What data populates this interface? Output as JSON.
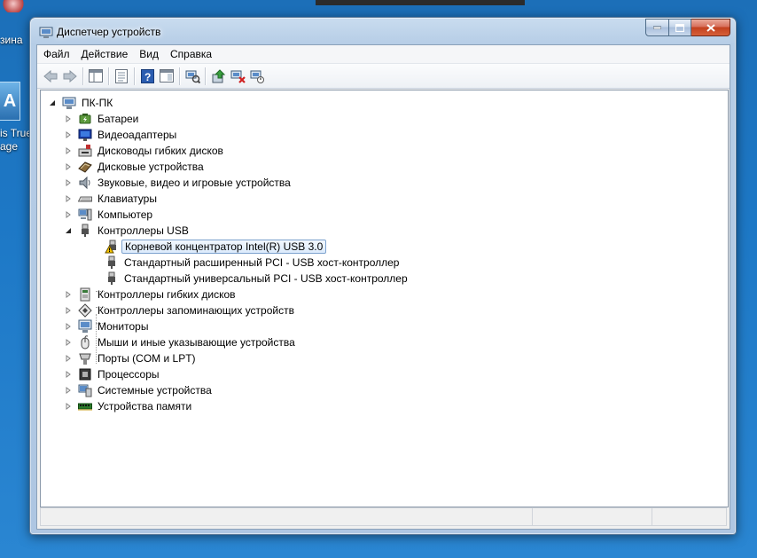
{
  "desktop": {
    "label_top": "зина",
    "label_mid1": "is True",
    "label_mid2": "age",
    "app_icon_letter": "A"
  },
  "window": {
    "title": "Диспетчер устройств",
    "icon": "device-manager-icon"
  },
  "menu": [
    "Файл",
    "Действие",
    "Вид",
    "Справка"
  ],
  "toolbar": {
    "buttons": [
      "back-icon",
      "forward-icon",
      "show-hide-console-tree-icon",
      "properties-icon",
      "help-icon",
      "action-pane-icon",
      "scan-hardware-icon",
      "update-driver-icon",
      "uninstall-icon",
      "enable-device-icon"
    ]
  },
  "tree": {
    "root": "ПК-ПК",
    "categories": [
      {
        "label": "Батареи",
        "icon": "battery-icon"
      },
      {
        "label": "Видеоадаптеры",
        "icon": "display-adapter-icon"
      },
      {
        "label": "Дисководы гибких дисков",
        "icon": "floppy-drive-icon"
      },
      {
        "label": "Дисковые устройства",
        "icon": "disk-drive-icon"
      },
      {
        "label": "Звуковые, видео и игровые устройства",
        "icon": "speaker-icon"
      },
      {
        "label": "Клавиатуры",
        "icon": "keyboard-icon"
      },
      {
        "label": "Компьютер",
        "icon": "computer-icon"
      },
      {
        "label": "Контроллеры USB",
        "icon": "usb-icon",
        "expanded": true,
        "children": [
          {
            "label": "Корневой концентратор Intel(R) USB 3.0",
            "icon": "usb-warning-icon",
            "selected": true
          },
          {
            "label": "Стандартный расширенный PCI - USB хост-контроллер",
            "icon": "usb-icon"
          },
          {
            "label": "Стандартный универсальный PCI - USB хост-контроллер",
            "icon": "usb-icon"
          }
        ]
      },
      {
        "label": "Контроллеры гибких дисков",
        "icon": "floppy-controller-icon"
      },
      {
        "label": "Контроллеры запоминающих устройств",
        "icon": "storage-controller-icon"
      },
      {
        "label": "Мониторы",
        "icon": "monitor-icon"
      },
      {
        "label": "Мыши и иные указывающие устройства",
        "icon": "mouse-icon"
      },
      {
        "label": "Порты (COM и LPT)",
        "icon": "port-icon"
      },
      {
        "label": "Процессоры",
        "icon": "processor-icon"
      },
      {
        "label": "Системные устройства",
        "icon": "system-device-icon"
      },
      {
        "label": "Устройства памяти",
        "icon": "memory-icon"
      }
    ]
  },
  "colors": {
    "desktop": "#1d78c6",
    "selection": "#dcebfc",
    "warning": "#f5c400"
  }
}
